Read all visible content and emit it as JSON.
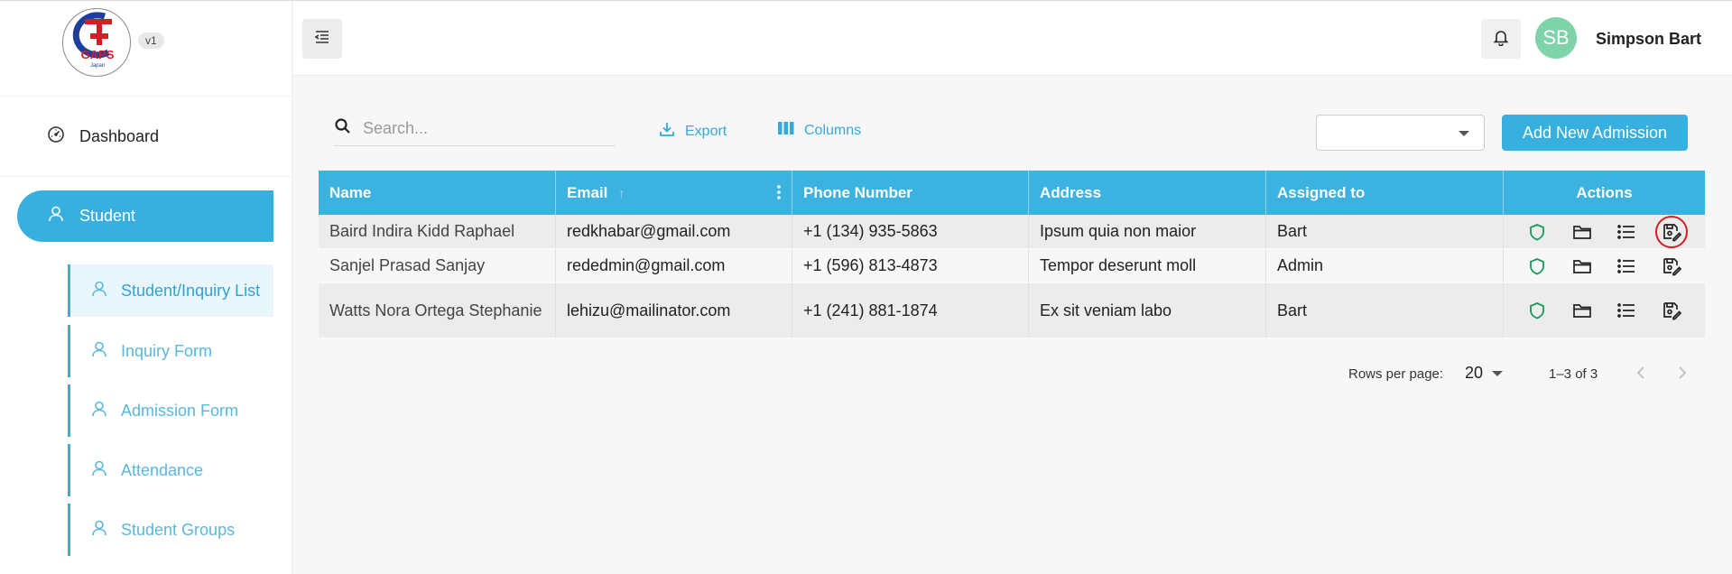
{
  "brand": {
    "logo_text": "GAPS",
    "logo_subtext": "Japan",
    "version": "v1"
  },
  "sidebar": {
    "dashboard_label": "Dashboard",
    "student_label": "Student",
    "sub_items": [
      {
        "label": "Student/Inquiry List",
        "active": true
      },
      {
        "label": "Inquiry Form",
        "active": false
      },
      {
        "label": "Admission Form",
        "active": false
      },
      {
        "label": "Attendance",
        "active": false
      },
      {
        "label": "Student Groups",
        "active": false
      }
    ]
  },
  "header": {
    "avatar_initials": "SB",
    "user_name": "Simpson Bart"
  },
  "toolbar": {
    "search_placeholder": "Search...",
    "export_label": "Export",
    "columns_label": "Columns",
    "select_value": "",
    "add_label": "Add New Admission"
  },
  "table": {
    "columns": [
      "Name",
      "Email",
      "Phone Number",
      "Address",
      "Assigned to",
      "Actions"
    ],
    "sort": {
      "column": "Email",
      "direction": "ascending"
    },
    "rows": [
      {
        "name": "Baird Indira Kidd Raphael",
        "email": "redkhabar@gmail.com",
        "phone": "+1 (134) 935-5863",
        "address": "Ipsum quia non maior",
        "assigned": "Bart"
      },
      {
        "name": "Sanjel Prasad Sanjay",
        "email": "rededmin@gmail.com",
        "phone": "+1 (596) 813-4873",
        "address": "Tempor deserunt moll",
        "assigned": "Admin"
      },
      {
        "name": "Watts Nora Ortega Stephanie",
        "email": "lehizu@mailinator.com",
        "phone": "+1 (241) 881-1874",
        "address": "Ex sit veniam labo",
        "assigned": "Bart"
      }
    ],
    "action_icons": [
      "shield-icon",
      "folder-icon",
      "list-icon",
      "save-edit-icon"
    ]
  },
  "pagination": {
    "rows_per_page_label": "Rows per page:",
    "rows_per_page": "20",
    "range": "1–3 of 3"
  },
  "colors": {
    "accent": "#37b0e0",
    "avatar": "#7ed4a8",
    "shield": "#1a9b5a",
    "highlight": "#d42020"
  }
}
